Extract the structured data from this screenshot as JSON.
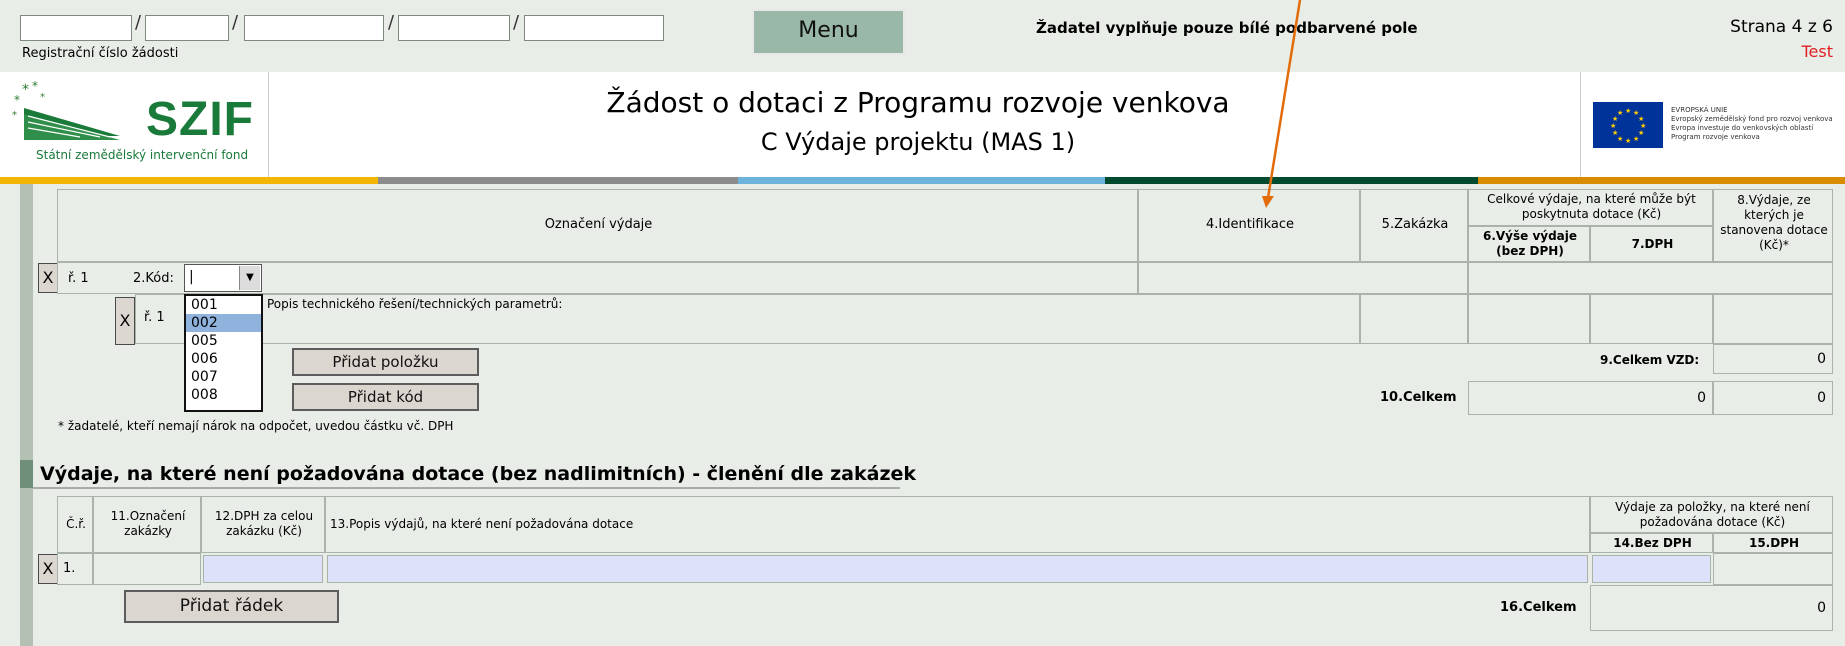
{
  "top": {
    "reg_label": "Registrační číslo žádosti",
    "menu_label": "Menu",
    "notice": "Žadatel vyplňuje pouze bílé podbarvené pole",
    "page": "Strana 4 z 6",
    "mode": "Test"
  },
  "header": {
    "logo_text": "SZIF",
    "logo_sub": "Státní zemědělský intervenční fond",
    "title": "Žádost o dotaci z Programu rozvoje venkova",
    "subtitle": "C Výdaje projektu (MAS 1)",
    "eu_lines": [
      "EVROPSKÁ UNIE",
      "Evropský zemědělský fond pro rozvoj venkova",
      "Evropa investuje do venkovských oblastí",
      "Program rozvoje venkova"
    ]
  },
  "colors": {
    "stripe": [
      "#f2b600",
      "#8c8c8c",
      "#6cb4dc",
      "#004b2e",
      "#d98c00"
    ],
    "arrow": "#e36c0a",
    "blue_field": "#dde2fa"
  },
  "table1": {
    "h_oznaceni": "Označení výdaje",
    "h_ident": "4.Identifikace",
    "h_zakazka": "5.Zakázka",
    "h_celkove": "Celkové výdaje, na které může být poskytnuta dotace (Kč)",
    "h_vyse": "6.Výše výdaje (bez DPH)",
    "h_dph": "7.DPH",
    "h_vydaje": "8.Výdaje, ze kterých je stanovena dotace (Kč)*",
    "x": "X",
    "row_label": "ř. 1",
    "kod_label": "2.Kód:",
    "kod_value": "|",
    "sub_row_label": "ř. 1",
    "popis_label": "Popis technického řešení/technických parametrů:",
    "dropdown_options": [
      "001",
      "002",
      "005",
      "006",
      "007",
      "008"
    ],
    "dropdown_selected": "002",
    "btn_add_item": "Přidat položku",
    "btn_add_code": "Přidat kód",
    "celkem_vzd_label": "9.Celkem VZD:",
    "celkem_vzd_value": "0",
    "celkem_label": "10.Celkem",
    "celkem_v1": "0",
    "celkem_v2": "0",
    "footnote": "* žadatelé, kteří nemají nárok na odpočet, uvedou částku vč. DPH"
  },
  "section2": {
    "title": "Výdaje, na které není požadována dotace (bez nadlimitních) - členění dle zakázek",
    "h_cr": "Č.ř.",
    "h_11": "11.Označení zakázky",
    "h_12": "12.DPH za celou zakázku (Kč)",
    "h_13": "13.Popis výdajů, na které není požadována dotace",
    "h_group": "Výdaje za položky, na které není požadována dotace (Kč)",
    "h_14": "14.Bez DPH",
    "h_15": "15.DPH",
    "x": "X",
    "row_num": "1.",
    "btn_add_row": "Přidat řádek",
    "celkem_label": "16.Celkem",
    "celkem_value": "0"
  }
}
